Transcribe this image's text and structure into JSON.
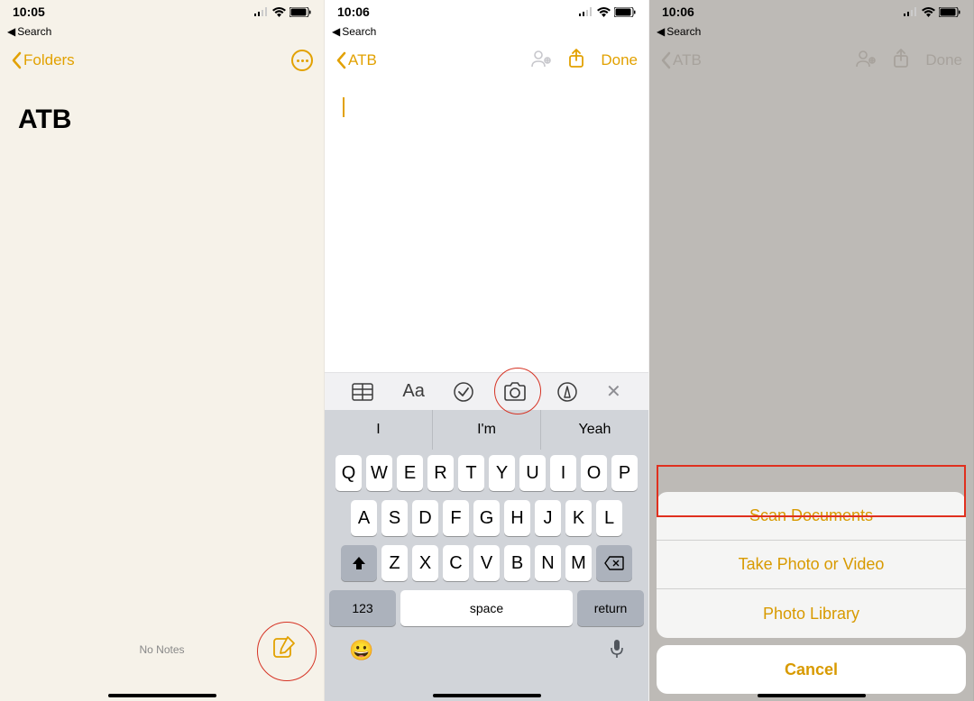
{
  "colors": {
    "accent": "#e2a100",
    "red": "#e0301e"
  },
  "screen1": {
    "time": "10:05",
    "back_label": "Search",
    "nav_back": "Folders",
    "note_title": "ATB",
    "empty_text": "No Notes"
  },
  "screen2": {
    "time": "10:06",
    "back_label": "Search",
    "nav_back": "ATB",
    "done_label": "Done",
    "toolbar_aa": "Aa",
    "suggestions": [
      "I",
      "I'm",
      "Yeah"
    ],
    "rows": [
      [
        "Q",
        "W",
        "E",
        "R",
        "T",
        "Y",
        "U",
        "I",
        "O",
        "P"
      ],
      [
        "A",
        "S",
        "D",
        "F",
        "G",
        "H",
        "J",
        "K",
        "L"
      ],
      [
        "Z",
        "X",
        "C",
        "V",
        "B",
        "N",
        "M"
      ]
    ],
    "num_key": "123",
    "space_key": "space",
    "return_key": "return"
  },
  "screen3": {
    "time": "10:06",
    "back_label": "Search",
    "nav_back": "ATB",
    "done_label": "Done",
    "sheet": {
      "items": [
        "Scan Documents",
        "Take Photo or Video",
        "Photo Library"
      ],
      "cancel": "Cancel"
    }
  }
}
